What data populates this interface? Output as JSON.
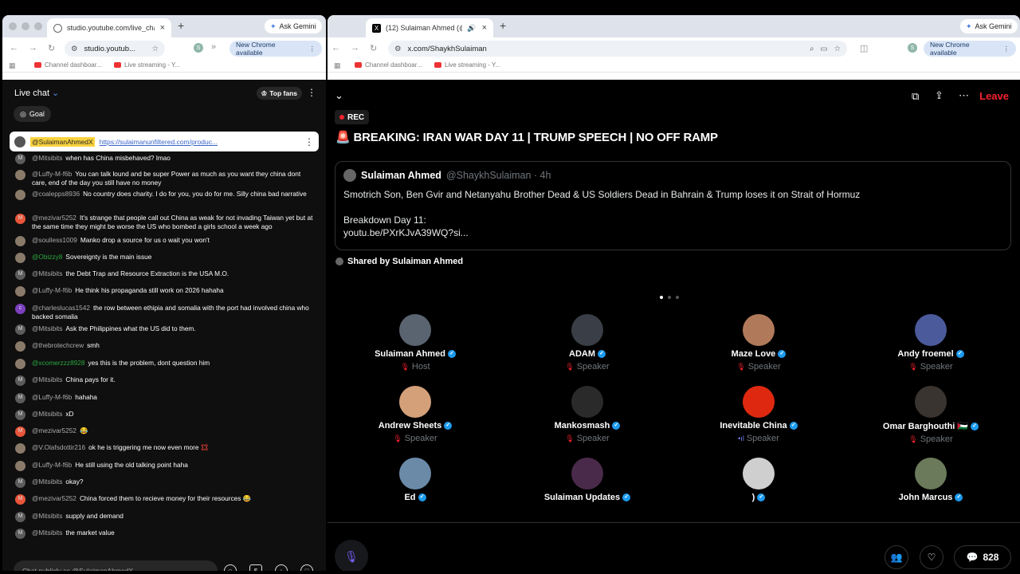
{
  "left_window": {
    "tab_title": "studio.youtube.com/live_chat",
    "url": "studio.youtub...",
    "ask_gemini": "Ask Gemini",
    "new_chrome": "New Chrome available",
    "profile_initial": "S",
    "bookmarks": [
      "Channel dashboar...",
      "Live streaming - Y..."
    ]
  },
  "right_window": {
    "tab_title": "(12) Sulaiman Ahmed (@S",
    "url": "x.com/ShaykhSulaiman",
    "ask_gemini": "Ask Gemini",
    "new_chrome": "New Chrome available",
    "profile_initial": "S",
    "bookmarks": [
      "Channel dashboar...",
      "Live streaming - Y..."
    ]
  },
  "chat": {
    "title": "Live chat",
    "top_fans": "Top fans",
    "goal": "Goal",
    "pinned": {
      "user": "@SulaimanAhmedX",
      "link": "https://sulaimanunfiltered.com/produc..."
    },
    "messages": [
      {
        "avatar": "M",
        "user": "@Mitsibits",
        "text": "when has China misbehaved? lmao",
        "green": false
      },
      {
        "avatar": "",
        "user": "@Luffy-M-f6b",
        "text": "You can talk lound and be super Power as much as you want they china dont care, end of the day you still have no money",
        "green": false
      },
      {
        "avatar": "",
        "user": "@coalepps8936",
        "text": "No country does charity. I do for you, you do for me. Silly china bad narrative",
        "green": false
      },
      {
        "avatar": "M",
        "user": "@mezivar5252",
        "text": "It's strange that people call out China as weak for not invading Taiwan yet but at the same time they might be worse the US who bombed a girls school a week ago",
        "green": false
      },
      {
        "avatar": "",
        "user": "@soulless1009",
        "text": "Manko drop a source for us o wait you won't",
        "green": false
      },
      {
        "avatar": "",
        "user": "@Obizzy8",
        "text": "Sovereignty is the main issue",
        "green": true
      },
      {
        "avatar": "M",
        "user": "@Mitsibits",
        "text": "the Debt Trap and Resource Extraction is the USA M.O.",
        "green": false
      },
      {
        "avatar": "",
        "user": "@Luffy-M-f6b",
        "text": "He think his propaganda still work on 2026 hahaha",
        "green": false
      },
      {
        "avatar": "c",
        "user": "@charleslucas1542",
        "text": "the row between ethipia and somalia with the port had involved china who backed somalia",
        "green": false
      },
      {
        "avatar": "M",
        "user": "@Mitsibits",
        "text": "Ask the Philippines what the US did to them.",
        "green": false
      },
      {
        "avatar": "",
        "user": "@thebrotechcrew",
        "text": "smh",
        "green": false
      },
      {
        "avatar": "",
        "user": "@xcomerzzz8928",
        "text": "yes this is the problem, dont question him",
        "green": true
      },
      {
        "avatar": "M",
        "user": "@Mitsibits",
        "text": "China pays for it.",
        "green": false
      },
      {
        "avatar": "M",
        "user": "@Luffy-M-f6b",
        "text": "hahaha",
        "green": false
      },
      {
        "avatar": "M",
        "user": "@Mitsibits",
        "text": "xD",
        "green": false
      },
      {
        "avatar": "M",
        "user": "@mezivar5252",
        "text": "😂",
        "green": false
      },
      {
        "avatar": "",
        "user": "@V.Olafsdottir216",
        "text": "ok he is triggering me now even more 💢",
        "green": false
      },
      {
        "avatar": "",
        "user": "@Luffy-M-f6b",
        "text": "He still using the old talking point haha",
        "green": false
      },
      {
        "avatar": "M",
        "user": "@Mitsibits",
        "text": "okay?",
        "green": false
      },
      {
        "avatar": "M",
        "user": "@mezivar5252",
        "text": "China forced them to recieve money for their resources 😂",
        "green": false
      },
      {
        "avatar": "M",
        "user": "@Mitsibits",
        "text": "supply and demand",
        "green": false
      },
      {
        "avatar": "M",
        "user": "@Mitsibits",
        "text": "the market value",
        "green": false
      }
    ],
    "input_placeholder": "Chat publicly as @SulaimanAhmedX..."
  },
  "space": {
    "rec": "REC",
    "leave": "Leave",
    "title": "BREAKING: IRAN WAR DAY 11 | TRUMP SPEECH | NO OFF RAMP",
    "tweet": {
      "name": "Sulaiman Ahmed",
      "handle": "@ShaykhSulaiman · 4h",
      "line1": "Smotrich Son, Ben Gvir and Netanyahu Brother Dead & US Soldiers Dead in Bahrain & Trump loses it on Strait of Hormuz",
      "line2": "Breakdown Day 11:",
      "line3": "youtu.be/PXrKJvA39WQ?si..."
    },
    "shared_by": "Shared by Sulaiman Ahmed",
    "speakers": [
      {
        "name": "Sulaiman Ahmed",
        "role": "Host",
        "verified": true,
        "color": "#5a6470"
      },
      {
        "name": "ADAM",
        "role": "Speaker",
        "verified": true,
        "color": "#3a3f47"
      },
      {
        "name": "Maze Love",
        "role": "Speaker",
        "verified": true,
        "color": "#b07a5a"
      },
      {
        "name": "Andy froemel",
        "role": "Speaker",
        "verified": true,
        "color": "#4a5a9a"
      },
      {
        "name": "Andrew Sheets",
        "role": "Speaker",
        "verified": true,
        "color": "#d4a07a"
      },
      {
        "name": "Mankosmash",
        "role": "Speaker",
        "verified": true,
        "color": "#2a2a2a"
      },
      {
        "name": "Inevitable China",
        "role": "Speaker",
        "verified": true,
        "color": "#de2910"
      },
      {
        "name": "Omar Barghouthi 🇵🇸",
        "role": "Speaker",
        "verified": true,
        "color": "#3a3430"
      },
      {
        "name": "Ed",
        "role": "Speaker",
        "verified": true,
        "color": "#6a8aa8"
      },
      {
        "name": "Sulaiman Updates",
        "role": "Speaker",
        "verified": true,
        "color": "#4a2a4a"
      },
      {
        "name": ")",
        "role": "Speaker",
        "verified": true,
        "color": "#cfcfcf"
      },
      {
        "name": "John Marcus",
        "role": "Speaker",
        "verified": true,
        "color": "#6a7a5a"
      }
    ],
    "listener_count": "828"
  }
}
